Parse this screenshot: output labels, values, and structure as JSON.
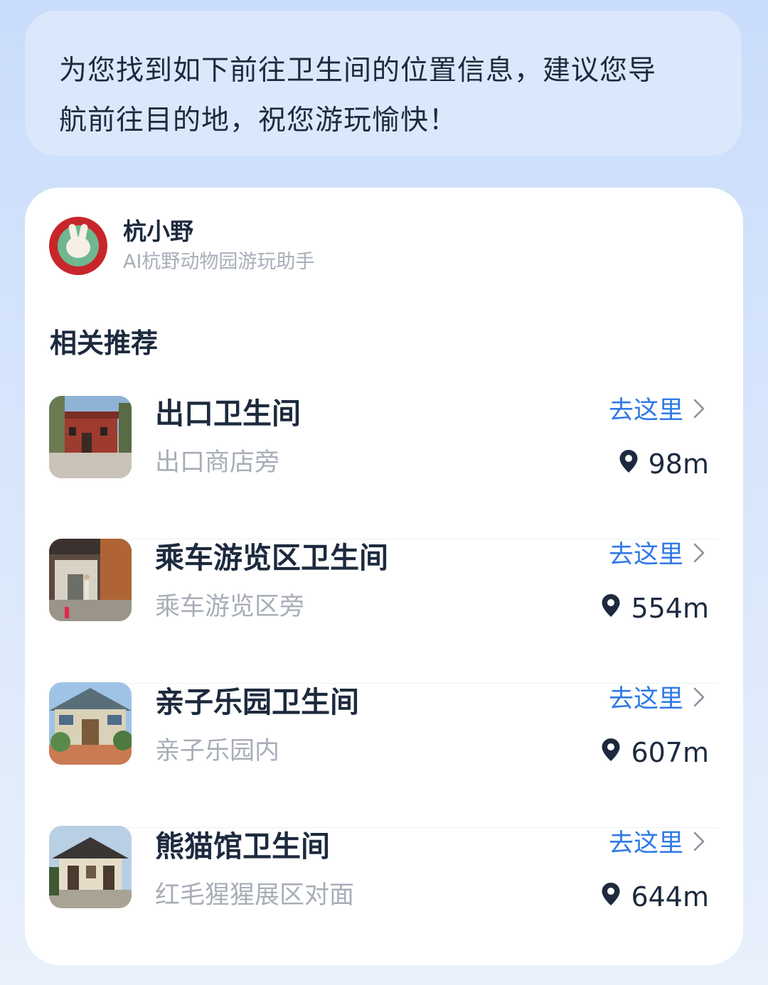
{
  "message": {
    "line1": "为您找到如下前往卫生间的位置信息，建议您导",
    "line2": "航前往目的地，祝您游玩愉快！"
  },
  "bot": {
    "name": "杭小野",
    "subtitle": "AI杭野动物园游玩助手",
    "avatar_icon": "rabbit-mascot-logo"
  },
  "section_title": "相关推荐",
  "colors": {
    "accent": "#2f7ae5",
    "title_text": "#1d2a3e",
    "secondary_text": "#a8aeb8",
    "background": "#c9dcfb"
  },
  "items": [
    {
      "title": "出口卫生间",
      "subtitle": "出口商店旁",
      "action": "去这里",
      "distance": "98m"
    },
    {
      "title": "乘车游览区卫生间",
      "subtitle": "乘车游览区旁",
      "action": "去这里",
      "distance": "554m"
    },
    {
      "title": "亲子乐园卫生间",
      "subtitle": "亲子乐园内",
      "action": "去这里",
      "distance": "607m"
    },
    {
      "title": "熊猫馆卫生间",
      "subtitle": "红毛猩猩展区对面",
      "action": "去这里",
      "distance": "644m"
    }
  ]
}
